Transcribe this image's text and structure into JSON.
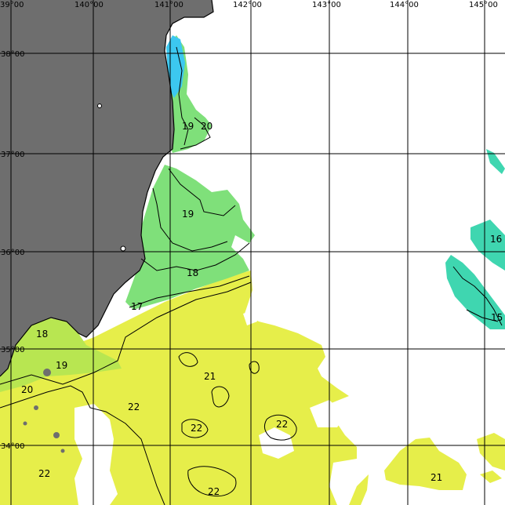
{
  "map": {
    "colors": {
      "land": "#6e6e6e",
      "warm": "#e6ee4a",
      "mid": "#b8e651",
      "green": "#7fe07a",
      "teal": "#3fd6b0",
      "cyan": "#3cc8f0",
      "nodata": "#ffffff"
    },
    "lon_labels": [
      "39°00",
      "140°00",
      "141°00",
      "142°00",
      "143°00",
      "144°00",
      "145°00"
    ],
    "lat_labels": [
      "38°00",
      "37°00",
      "36°00",
      "35°00",
      "34°00"
    ],
    "isotherm_labels": [
      {
        "id": "19a",
        "text": "19"
      },
      {
        "id": "20a",
        "text": "20"
      },
      {
        "id": "19b",
        "text": "19"
      },
      {
        "id": "18a",
        "text": "18"
      },
      {
        "id": "17a",
        "text": "17"
      },
      {
        "id": "18b",
        "text": "18"
      },
      {
        "id": "19c",
        "text": "19"
      },
      {
        "id": "20b",
        "text": "20"
      },
      {
        "id": "21a",
        "text": "21"
      },
      {
        "id": "22a",
        "text": "22"
      },
      {
        "id": "22b",
        "text": "22"
      },
      {
        "id": "22c",
        "text": "22"
      },
      {
        "id": "22d",
        "text": "22"
      },
      {
        "id": "22e",
        "text": "22"
      },
      {
        "id": "16a",
        "text": "16"
      },
      {
        "id": "15a",
        "text": "15"
      },
      {
        "id": "21b",
        "text": "21"
      }
    ]
  }
}
